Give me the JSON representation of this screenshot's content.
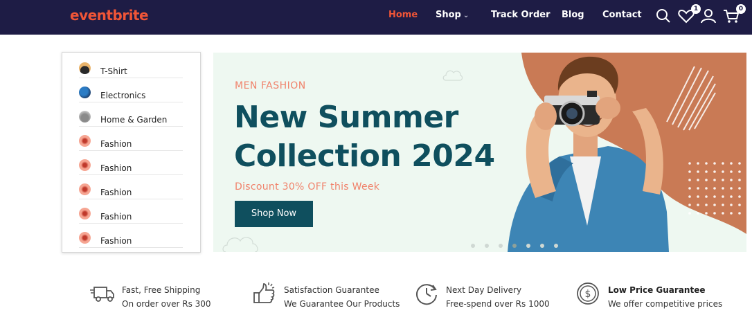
{
  "header": {
    "logo": "eventbrite",
    "nav": [
      {
        "label": "Home"
      },
      {
        "label": "Shop"
      },
      {
        "label": "Track Order"
      },
      {
        "label": "Blog"
      },
      {
        "label": "Contact"
      }
    ],
    "wishlist_count": "1",
    "cart_count": "0",
    "icons": [
      "search-icon",
      "heart-icon",
      "user-icon",
      "cart-icon"
    ]
  },
  "categories": [
    {
      "label": "T-Shirt",
      "icon": "tshirt-icon"
    },
    {
      "label": "Electronics",
      "icon": "electronics-icon"
    },
    {
      "label": "Home & Garden",
      "icon": "home-garden-icon"
    },
    {
      "label": "Fashion",
      "icon": "fashion-icon"
    },
    {
      "label": "Fashion",
      "icon": "fashion-icon"
    },
    {
      "label": "Fashion",
      "icon": "fashion-icon"
    },
    {
      "label": "Fashion",
      "icon": "fashion-icon"
    },
    {
      "label": "Fashion",
      "icon": "fashion-icon"
    }
  ],
  "hero": {
    "tag": "MEN FASHION",
    "title": "New Summer Collection 2024",
    "subtitle": "Discount 30% OFF this Week",
    "button": "Shop Now",
    "slides_total": 7,
    "active_slide": 4
  },
  "features": [
    {
      "title": "Fast, Free Shipping",
      "subtitle": "On order over Rs 300",
      "icon": "truck-icon"
    },
    {
      "title": "Satisfaction Guarantee",
      "subtitle": "We Guarantee Our Products",
      "icon": "thumbs-up-icon"
    },
    {
      "title": "Next Day Delivery",
      "subtitle": "Free-spend over Rs 1000",
      "icon": "clock-icon"
    },
    {
      "title": "Low Price Guarantee",
      "subtitle": "We offer competitive prices",
      "icon": "dollar-coin-icon"
    }
  ],
  "colors": {
    "header_bg": "#1e1c45",
    "accent": "#f05537",
    "primary": "#0f4f5e",
    "coral": "#f0826b",
    "hero_bg": "#eef8f1"
  }
}
